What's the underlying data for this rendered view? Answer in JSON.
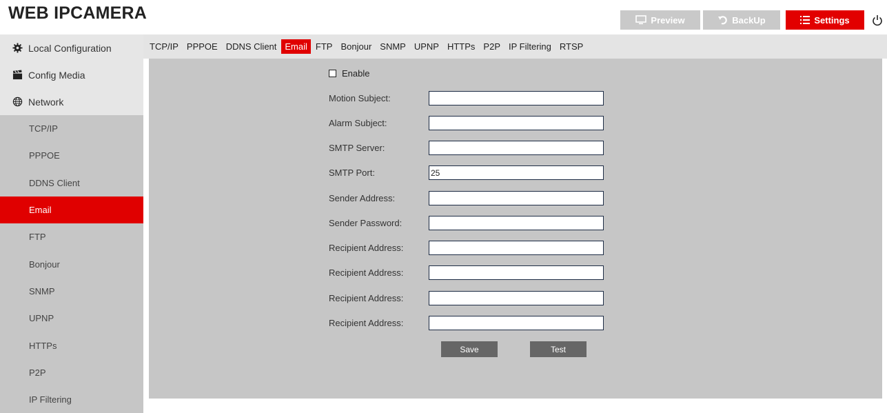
{
  "app": {
    "title": "WEB IPCAMERA"
  },
  "topnav": {
    "preview_label": "Preview",
    "backup_label": "BackUp",
    "settings_label": "Settings"
  },
  "sidebar": {
    "top_items": [
      {
        "label": "Local Configuration",
        "icon": "gear-icon"
      },
      {
        "label": "Config Media",
        "icon": "clapperboard-icon"
      },
      {
        "label": "Network",
        "icon": "globe-icon"
      }
    ],
    "sub_items": [
      {
        "label": "TCP/IP"
      },
      {
        "label": "PPPOE"
      },
      {
        "label": "DDNS Client"
      },
      {
        "label": "Email",
        "active": true
      },
      {
        "label": "FTP"
      },
      {
        "label": "Bonjour"
      },
      {
        "label": "SNMP"
      },
      {
        "label": "UPNP"
      },
      {
        "label": "HTTPs"
      },
      {
        "label": "P2P"
      },
      {
        "label": "IP Filtering"
      }
    ]
  },
  "tabs": [
    "TCP/IP",
    "PPPOE",
    "DDNS Client",
    "Email",
    "FTP",
    "Bonjour",
    "SNMP",
    "UPNP",
    "HTTPs",
    "P2P",
    "IP Filtering",
    "RTSP"
  ],
  "active_tab": "Email",
  "form": {
    "enable_label": "Enable",
    "enable_checked": false,
    "fields": [
      {
        "label": "Motion Subject:",
        "value": ""
      },
      {
        "label": "Alarm Subject:",
        "value": ""
      },
      {
        "label": "SMTP Server:",
        "value": ""
      },
      {
        "label": "SMTP Port:",
        "value": "25"
      },
      {
        "label": "Sender Address:",
        "value": ""
      },
      {
        "label": "Sender Password:",
        "value": ""
      },
      {
        "label": "Recipient Address:",
        "value": ""
      },
      {
        "label": "Recipient Address:",
        "value": ""
      },
      {
        "label": "Recipient Address:",
        "value": ""
      },
      {
        "label": "Recipient Address:",
        "value": ""
      }
    ],
    "save_label": "Save",
    "test_label": "Test"
  },
  "colors": {
    "accent": "#e20000",
    "inactive_button": "#c9c9c9",
    "panel": "#c6c6c6",
    "action_button": "#666666"
  }
}
